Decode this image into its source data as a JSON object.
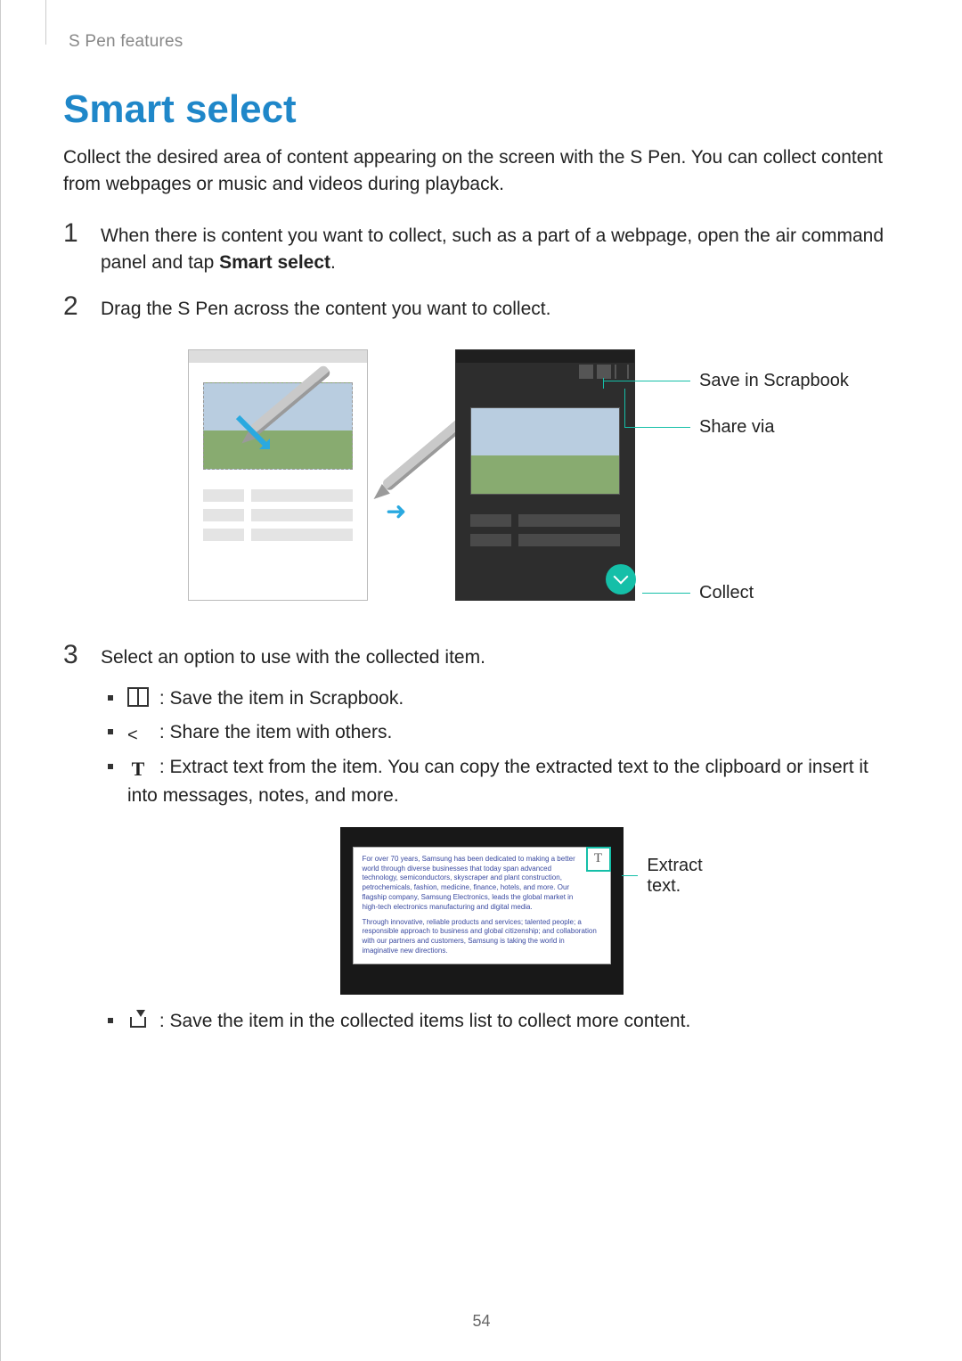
{
  "chapter": "S Pen features",
  "title": "Smart select",
  "intro": "Collect the desired area of content appearing on the screen with the S Pen. You can collect content from webpages or music and videos during playback.",
  "steps": {
    "1": {
      "num": "1",
      "text_a": "When there is content you want to collect, such as a part of a webpage, open the air command panel and tap ",
      "bold": "Smart select",
      "text_b": "."
    },
    "2": {
      "num": "2",
      "text": "Drag the S Pen across the content you want to collect."
    },
    "3": {
      "num": "3",
      "text": "Select an option to use with the collected item."
    }
  },
  "callouts": {
    "save_scrapbook": "Save in Scrapbook",
    "share_via": "Share via",
    "collect": "Collect",
    "extract_text": "Extract text."
  },
  "options": {
    "scrapbook": {
      "before": " : Save the item in ",
      "bold": "Scrapbook",
      "after": "."
    },
    "share": " : Share the item with others.",
    "extract": " : Extract text from the item. You can copy the extracted text to the clipboard or insert it into messages, notes, and more.",
    "download": " : Save the item in the collected items list to collect more content."
  },
  "figure2": {
    "t_label": "T",
    "para1": "For over 70 years, Samsung has been dedicated to making a better world through diverse businesses that today span advanced technology, semiconductors, skyscraper and plant construction, petrochemicals, fashion, medicine, finance, hotels, and more. Our flagship company, Samsung Electronics, leads the global market in high-tech electronics manufacturing and digital media.",
    "para2": "Through innovative, reliable products and services; talented people; a responsible approach to business and global citizenship; and collaboration with our partners and customers, Samsung is taking the world in imaginative new directions."
  },
  "page_number": "54"
}
